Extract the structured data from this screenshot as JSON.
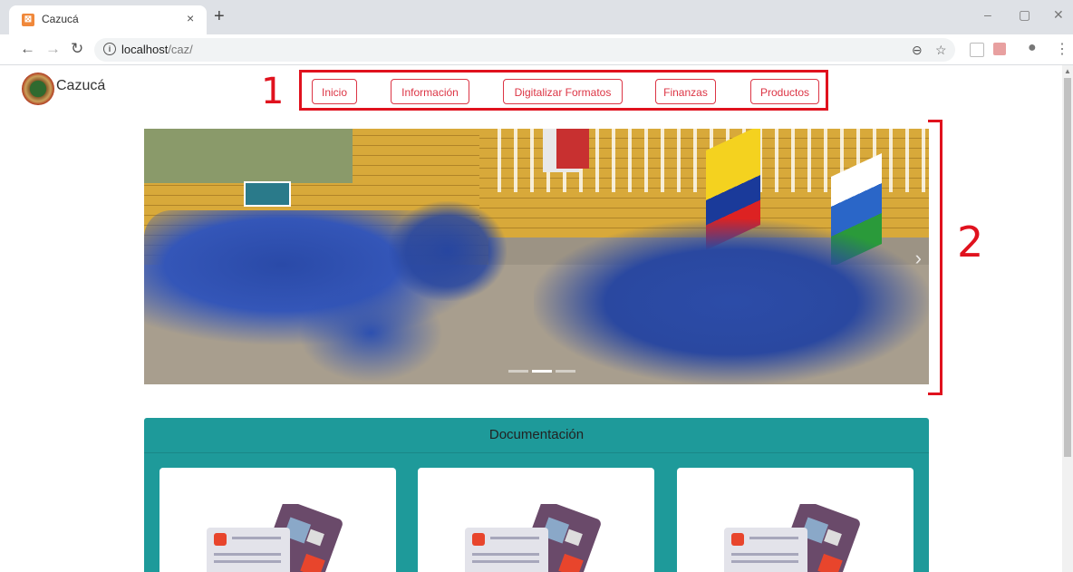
{
  "browser": {
    "tab_title": "Cazucá",
    "tab_close": "×",
    "new_tab": "+",
    "url_host": "localhost",
    "url_path": "/caz/",
    "window_controls": [
      "–",
      "▢",
      "✕"
    ]
  },
  "page": {
    "brand": "Cazucá",
    "nav": [
      {
        "label": "Inicio"
      },
      {
        "label": "Información"
      },
      {
        "label": "Digitalizar Formatos"
      },
      {
        "label": "Finanzas"
      },
      {
        "label": "Productos"
      }
    ],
    "annotations": {
      "one": "1",
      "two": "2"
    },
    "carousel": {
      "slide_count": 3,
      "active_slide": 2
    },
    "documentation": {
      "title": "Documentación",
      "cards": [
        {
          "icon": "document-icon"
        },
        {
          "icon": "document-icon"
        },
        {
          "icon": "document-icon"
        }
      ]
    }
  },
  "colors": {
    "accent": "#dc3545",
    "annotation": "#e0121e",
    "doc_bg": "#1e9a9a"
  }
}
